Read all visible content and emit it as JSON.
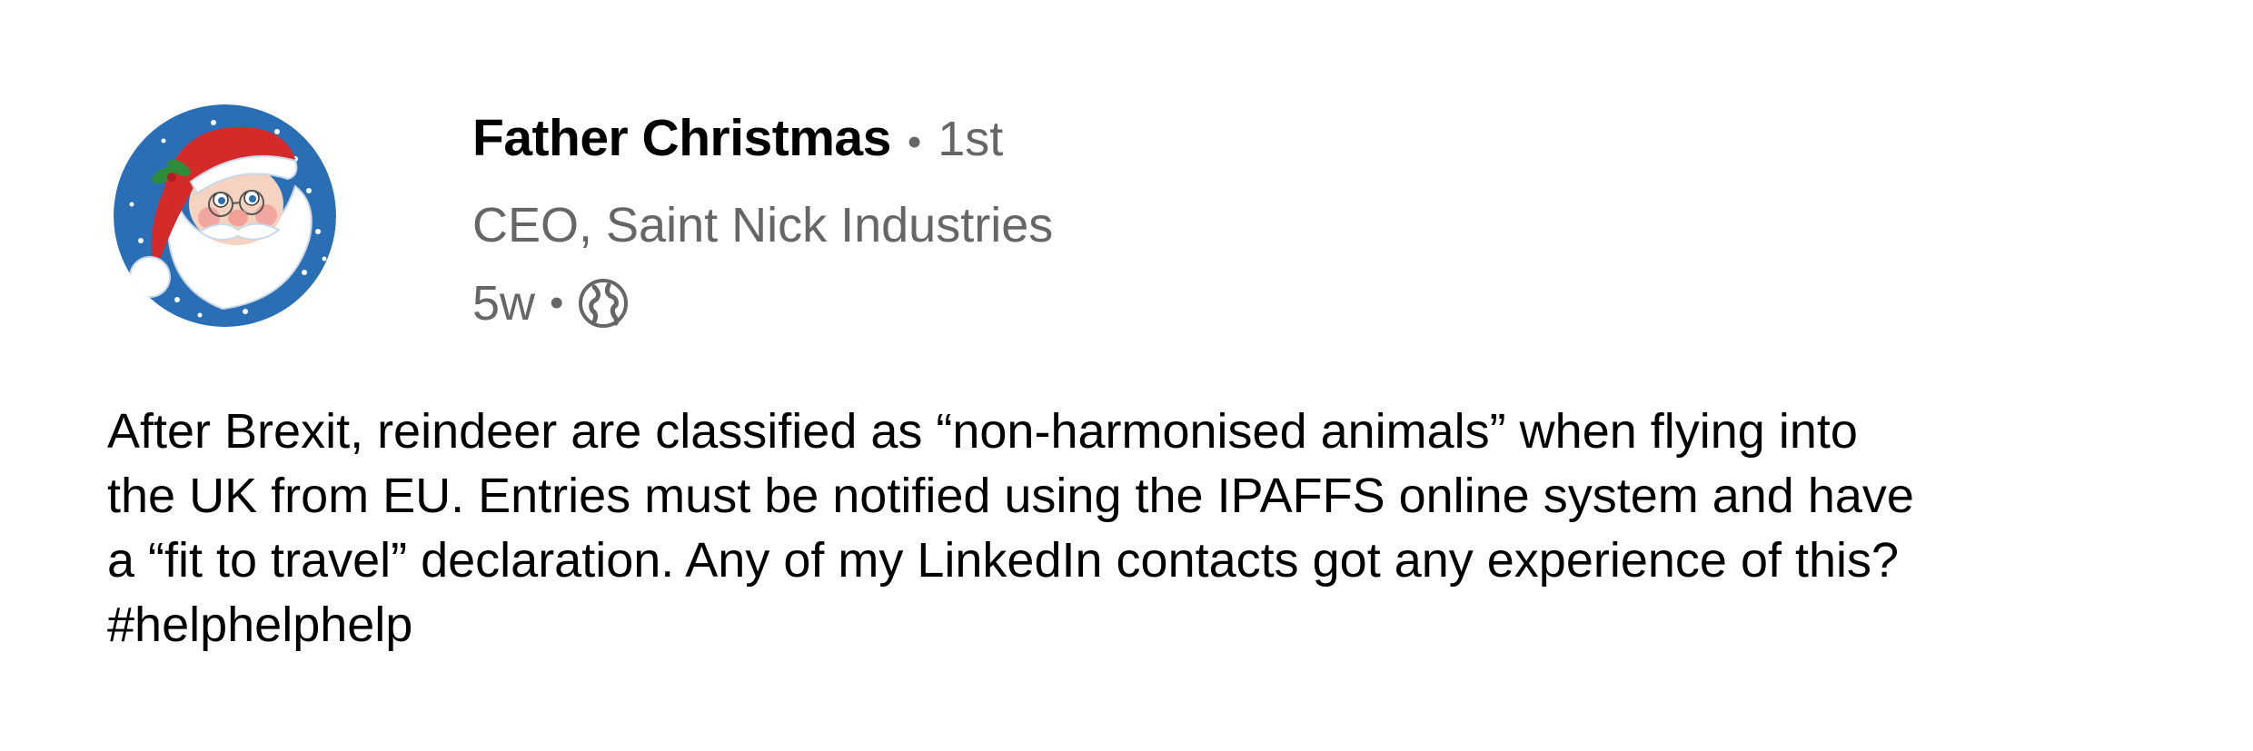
{
  "post": {
    "author": {
      "name": "Father Christmas",
      "degree": "1st",
      "headline": "CEO, Saint Nick Industries",
      "avatar_icon": "santa-avatar-icon"
    },
    "time_ago": "5w",
    "visibility_icon": "globe-icon",
    "separator": "•",
    "text": "After Brexit, reindeer are classified as “non-harmonised animals” when flying into\nthe UK from EU. Entries must be notified using the IPAFFS online system and have\na “fit to travel” declaration. Any of my LinkedIn contacts got any experience of this?\n#helphelphelp"
  },
  "colors": {
    "text_primary": "#000000",
    "text_secondary": "#666666",
    "avatar_bg": "#2a6fb5",
    "santa_hat": "#d42a2a"
  }
}
